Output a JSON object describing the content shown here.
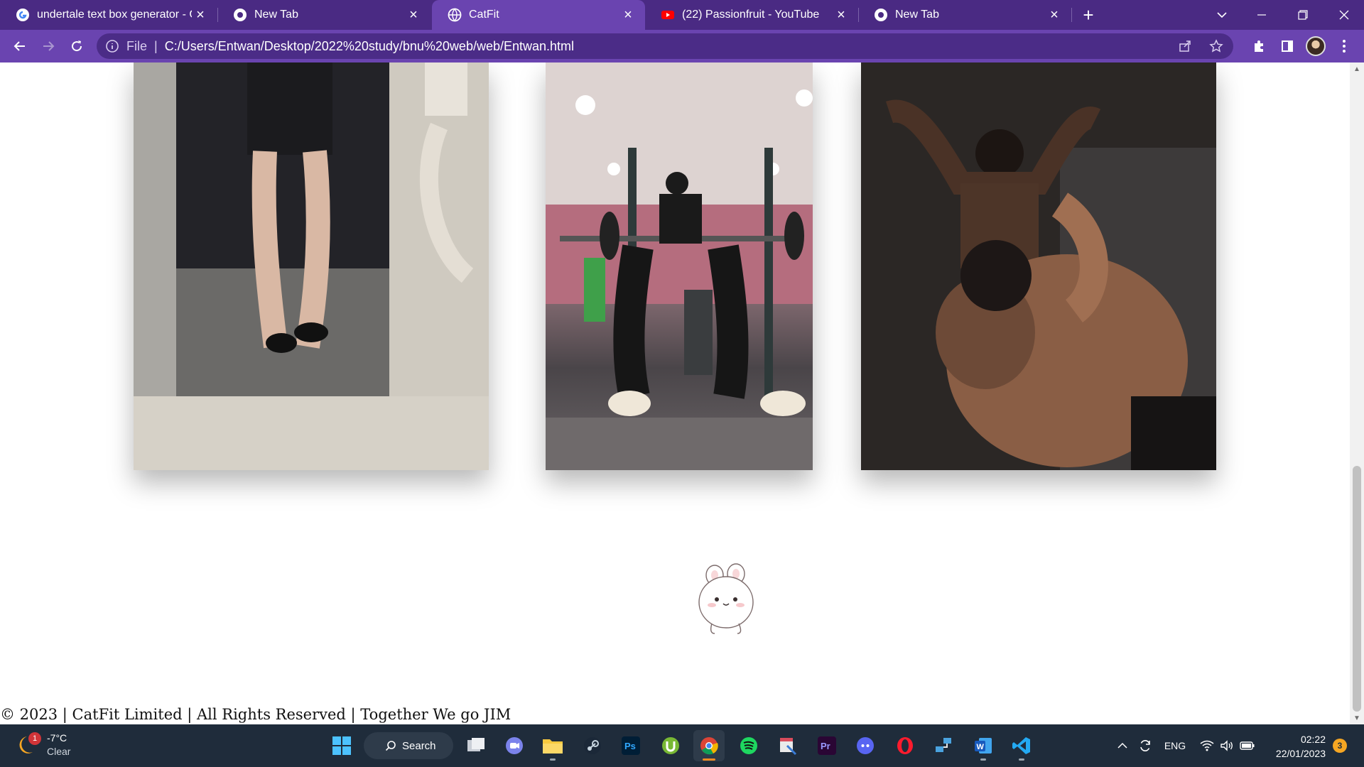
{
  "browser": {
    "tabs": [
      {
        "title": "undertale text box generator - Google Search",
        "icon": "google-icon",
        "active": false
      },
      {
        "title": "New Tab",
        "icon": "chrome-icon",
        "active": false
      },
      {
        "title": "CatFit",
        "icon": "globe-icon",
        "active": true
      },
      {
        "title": "(22) Passionfruit - YouTube",
        "icon": "youtube-icon",
        "active": false
      },
      {
        "title": "New Tab",
        "icon": "chrome-icon",
        "active": false
      }
    ],
    "new_tab_label": "+",
    "close_glyph": "×",
    "address": {
      "scheme_label": "File",
      "separator": "|",
      "url": "C:/Users/Entwan/Desktop/2022%20study/bnu%20web/web/Entwan.html"
    }
  },
  "page": {
    "images": [
      {
        "name": "legs-locker-room-photo"
      },
      {
        "name": "bench-press-photo"
      },
      {
        "name": "flexing-duo-photo"
      }
    ],
    "mascot": "bunny-mascot",
    "footer": "© 2023 | CatFit Limited | All Rights Reserved | Together We go JIM"
  },
  "taskbar": {
    "weather": {
      "badge": "1",
      "temp": "-7°C",
      "condition": "Clear"
    },
    "search_label": "Search",
    "apps": [
      "task-view",
      "teams",
      "file-explorer",
      "steam",
      "photoshop",
      "utorrent",
      "chrome",
      "spotify",
      "snipping-tool",
      "premiere-pro",
      "discord",
      "opera",
      "network-tool",
      "word",
      "vscode"
    ],
    "tray": {
      "language": "ENG"
    },
    "clock": {
      "time": "02:22",
      "date": "22/01/2023"
    },
    "notifications": "3"
  },
  "colors": {
    "tabstrip": "#4a2a83",
    "toolbar": "#6a44b0",
    "taskbar": "#1f2c3b"
  }
}
